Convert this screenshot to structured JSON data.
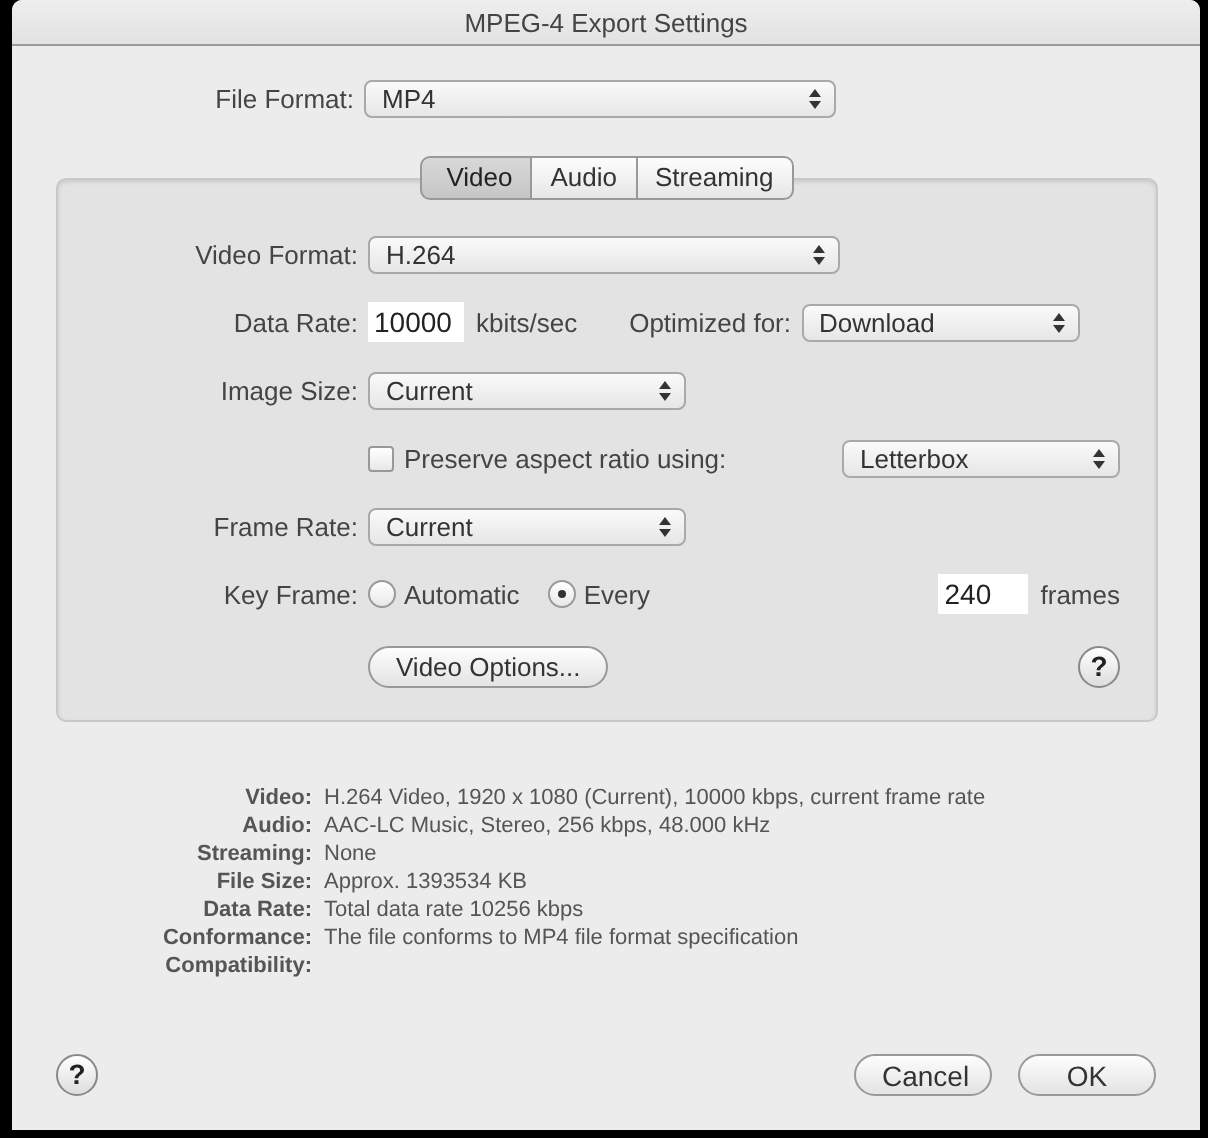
{
  "window": {
    "title": "MPEG-4 Export Settings"
  },
  "file_format": {
    "label": "File Format:",
    "value": "MP4"
  },
  "tabs": [
    {
      "label": "Video",
      "selected": true
    },
    {
      "label": "Audio",
      "selected": false
    },
    {
      "label": "Streaming",
      "selected": false
    }
  ],
  "video": {
    "video_format": {
      "label": "Video Format:",
      "value": "H.264"
    },
    "data_rate": {
      "label": "Data Rate:",
      "value": "10000",
      "unit": "kbits/sec"
    },
    "optimized_for": {
      "label": "Optimized for:",
      "value": "Download"
    },
    "image_size": {
      "label": "Image Size:",
      "value": "Current"
    },
    "preserve_aspect": {
      "label": "Preserve aspect ratio using:",
      "checked": false,
      "value": "Letterbox"
    },
    "frame_rate": {
      "label": "Frame Rate:",
      "value": "Current"
    },
    "key_frame": {
      "label": "Key Frame:",
      "options": [
        {
          "label": "Automatic",
          "selected": false
        },
        {
          "label": "Every",
          "selected": true
        }
      ],
      "value": "240",
      "unit": "frames"
    },
    "options_button": "Video Options...",
    "help": "?"
  },
  "summary": [
    {
      "label": "Video:",
      "value": "H.264 Video, 1920 x 1080 (Current), 10000 kbps, current frame rate"
    },
    {
      "label": "Audio:",
      "value": "AAC-LC Music, Stereo, 256 kbps, 48.000 kHz"
    },
    {
      "label": "Streaming:",
      "value": "None"
    },
    {
      "label": "File Size:",
      "value": "Approx. 1393534 KB"
    },
    {
      "label": "Data Rate:",
      "value": "Total data rate 10256 kbps"
    },
    {
      "label": "Conformance:",
      "value": "The file conforms to MP4 file format specification"
    },
    {
      "label": "Compatibility:"
    }
  ],
  "help": "?",
  "buttons": [
    "Cancel",
    "OK"
  ]
}
